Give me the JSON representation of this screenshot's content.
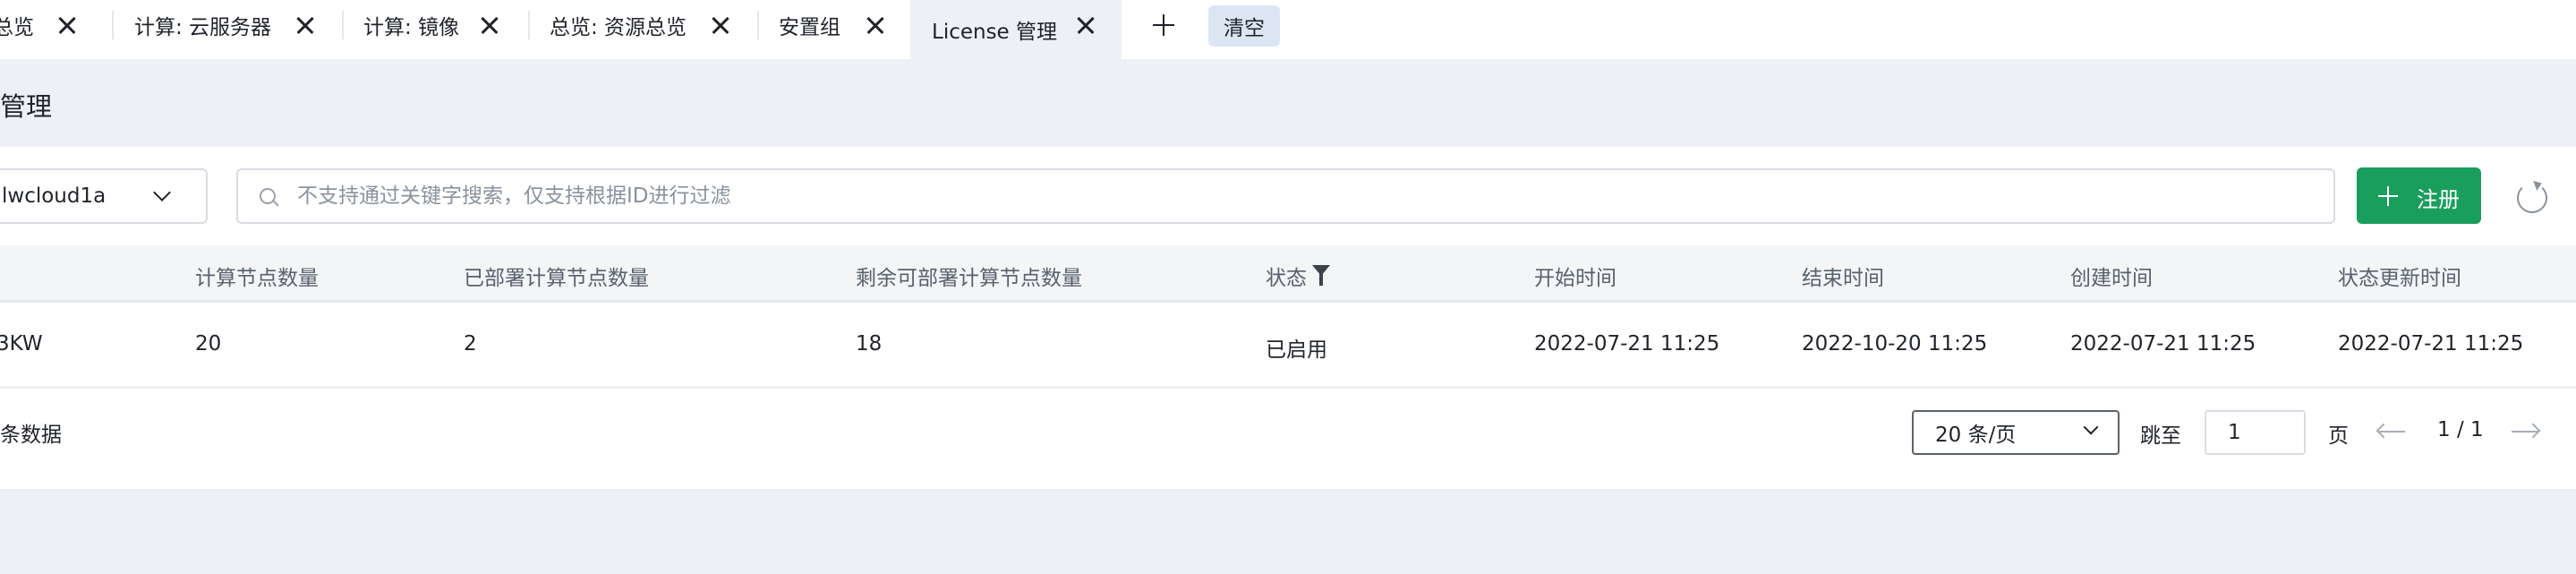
{
  "tabs": [
    {
      "label": "总览",
      "active": false
    },
    {
      "label": "计算: 云服务器",
      "active": false
    },
    {
      "label": "计算: 镜像",
      "active": false
    },
    {
      "label": "总览: 资源总览",
      "active": false
    },
    {
      "label": "安置组",
      "active": false
    },
    {
      "label": "License 管理",
      "active": true
    }
  ],
  "tabbar": {
    "add_icon": "plus-icon",
    "clear_label": "清空"
  },
  "page": {
    "title": "管理"
  },
  "toolbar": {
    "region_value": "lwcloud1a",
    "search_placeholder": "不支持通过关键字搜索，仅支持根据ID进行过滤",
    "register_label": "注册",
    "refresh_icon": "refresh-icon"
  },
  "table": {
    "columns": [
      "",
      "计算节点数量",
      "已部署计算节点数量",
      "剩余可部署计算节点数量",
      "状态",
      "开始时间",
      "结束时间",
      "创建时间",
      "状态更新时间"
    ],
    "rows": [
      [
        "3KW",
        "20",
        "2",
        "18",
        "已启用",
        "2022-07-21 11:25",
        "2022-10-20 11:25",
        "2022-07-21 11:25",
        "2022-07-21 11:25"
      ]
    ]
  },
  "footer": {
    "total_text": "条数据",
    "page_size": "20 条/页",
    "jump_label": "跳至",
    "jump_value": "1",
    "page_unit": "页",
    "page_indicator": "1 / 1"
  },
  "colors": {
    "accent": "#1a9e5c",
    "background": "#edf1f5",
    "active_tab": "#edf1f5",
    "clear_button": "#dce6f2"
  }
}
